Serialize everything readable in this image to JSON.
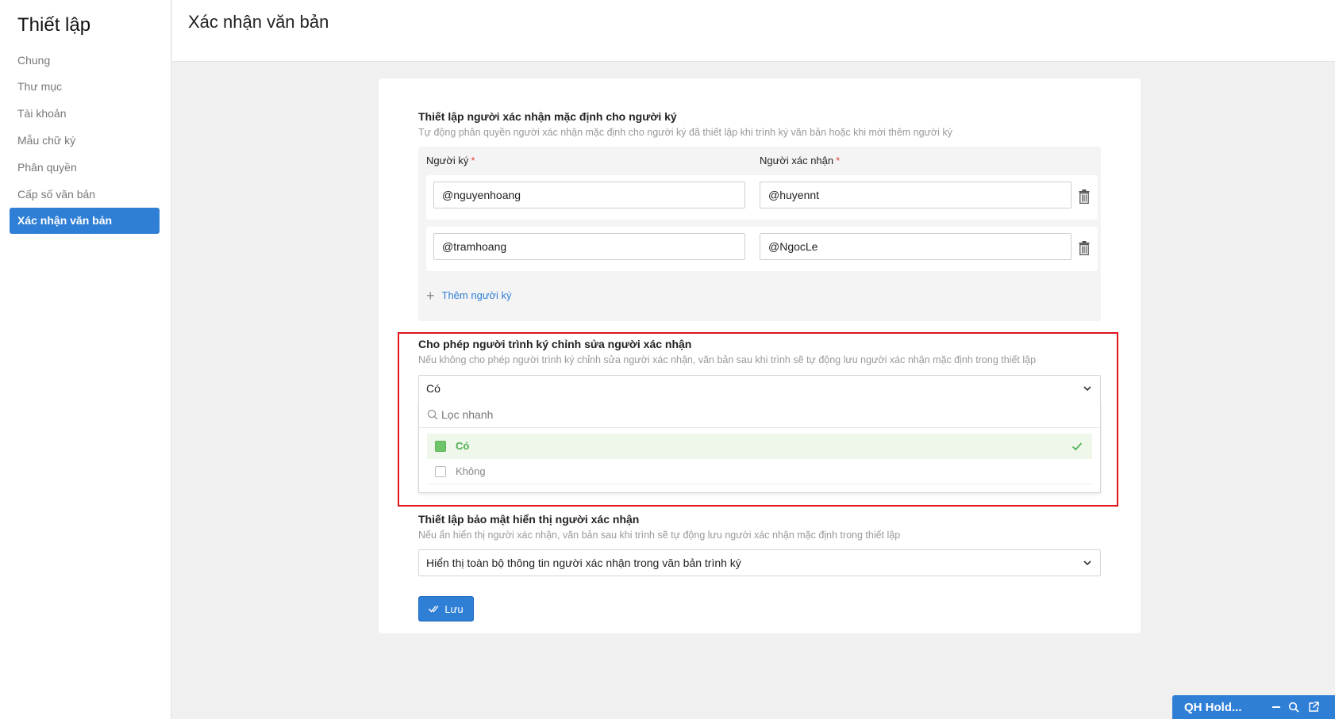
{
  "sidebar": {
    "title": "Thiết lập",
    "items": [
      {
        "label": "Chung"
      },
      {
        "label": "Thư mục"
      },
      {
        "label": "Tài khoản"
      },
      {
        "label": "Mẫu chữ ký"
      },
      {
        "label": "Phân quyền"
      },
      {
        "label": "Cấp số văn bản"
      },
      {
        "label": "Xác nhận văn bản",
        "active": true
      }
    ]
  },
  "header": {
    "title": "Xác nhận văn bản"
  },
  "default_confirmer": {
    "title": "Thiết lập người xác nhận mặc định cho người ký",
    "description": "Tự động phân quyền người xác nhận mặc định cho người ký đã thiết lập khi trình ký văn bản hoặc khi mời thêm người ký",
    "signer_label": "Người ký",
    "confirmer_label": "Người xác nhận",
    "required_mark": "*",
    "rows": [
      {
        "signer": "@nguyenhoang",
        "confirmer": "@huyennt"
      },
      {
        "signer": "@tramhoang",
        "confirmer": "@NgocLe"
      }
    ],
    "add_label": "Thêm người ký"
  },
  "allow_edit": {
    "title": "Cho phép người trình ký chỉnh sửa người xác nhận",
    "description": "Nếu không cho phép người trình ký chỉnh sửa người xác nhận, văn bản sau khi trình sẽ tự động lưu người xác nhận mặc định trong thiết lập",
    "selected": "Có",
    "search_placeholder": "Lọc nhanh",
    "options": [
      {
        "label": "Có",
        "selected": true
      },
      {
        "label": "Không",
        "selected": false
      }
    ]
  },
  "privacy": {
    "title": "Thiết lập bảo mật hiển thị người xác nhận",
    "description": "Nếu ẩn hiển thị người xác nhận, văn bản sau khi trình sẽ tự động lưu người xác nhận mặc định trong thiết lập",
    "selected": "Hiển thị toàn bộ thông tin người xác nhận trong văn bản trình ký"
  },
  "save_label": "Lưu",
  "chat": {
    "title": "QH Hold..."
  },
  "colors": {
    "accent": "#2f7fd6",
    "highlight": "#e0141b",
    "selected_option": "#4caf50"
  }
}
